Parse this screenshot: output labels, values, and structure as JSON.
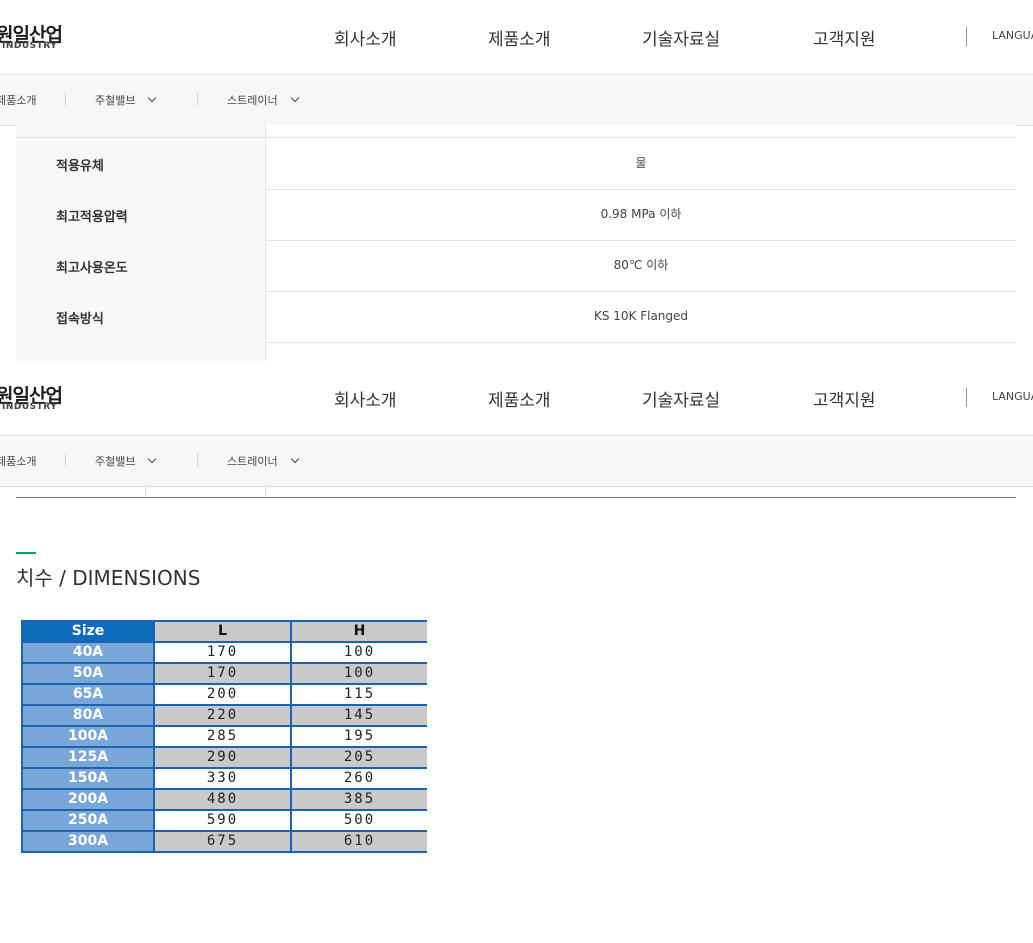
{
  "header": {
    "logo_main": "원일산업",
    "logo_sub": "INDUSTRY",
    "nav": [
      "회사소개",
      "제품소개",
      "기술자료실",
      "고객지원"
    ],
    "language": "LANGUA"
  },
  "subnav": {
    "home": "제품소개",
    "items": [
      "주철밸브",
      "스트레이너"
    ]
  },
  "spec_table": {
    "rows": [
      {
        "label": "적용유체",
        "value": "물"
      },
      {
        "label": "최고적용압력",
        "value": "0.98 MPa 이하"
      },
      {
        "label": "최고사용온도",
        "value": "80℃ 이하"
      },
      {
        "label": "접속방식",
        "value": "KS 10K Flanged"
      }
    ]
  },
  "dimensions": {
    "title": "치수 / DIMENSIONS",
    "headers": [
      "Size",
      "L",
      "H"
    ],
    "rows": [
      [
        "40A",
        "170",
        "100"
      ],
      [
        "50A",
        "170",
        "100"
      ],
      [
        "65A",
        "200",
        "115"
      ],
      [
        "80A",
        "220",
        "145"
      ],
      [
        "100A",
        "285",
        "195"
      ],
      [
        "125A",
        "290",
        "205"
      ],
      [
        "150A",
        "330",
        "260"
      ],
      [
        "200A",
        "480",
        "385"
      ],
      [
        "250A",
        "590",
        "500"
      ],
      [
        "300A",
        "675",
        "610"
      ]
    ]
  },
  "colors": {
    "accent_green": "#1a9a63",
    "table_header_blue": "#0d6bbb",
    "table_size_blue": "#7aa7d9",
    "table_border": "#1b63ad",
    "table_gray": "#c8c9cb"
  }
}
